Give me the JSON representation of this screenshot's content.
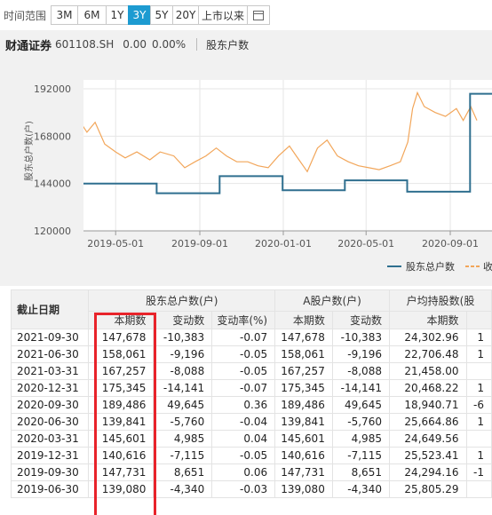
{
  "range_bar": {
    "label": "时间范围",
    "buttons": [
      "3M",
      "6M",
      "1Y",
      "3Y",
      "5Y",
      "20Y",
      "上市以来"
    ],
    "active_index": 3,
    "calendar_icon": "calendar-icon"
  },
  "header": {
    "stock_name": "财通证券",
    "stock_code": "601108.SH",
    "price": "0.00",
    "change_pct": "0.00%",
    "metric": "股东户数"
  },
  "colors": {
    "accent": "#1d9bd1",
    "holders_line": "#2f6f8f",
    "price_line": "#f2a65a",
    "highlight": "#e8232a"
  },
  "chart_data": {
    "type": "line",
    "ylabel": "股东总户数(户)",
    "yticks": [
      "192000",
      "168000",
      "144000",
      "120000"
    ],
    "ylim": [
      120000,
      192000
    ],
    "xticks": [
      "2019-05-01",
      "2019-09-01",
      "2020-01-01",
      "2020-05-01",
      "2020-09-01"
    ],
    "grid": true,
    "legend_position": "bottom-right",
    "legend": [
      "股东总户数",
      "收"
    ],
    "series": [
      {
        "name": "股东总户数",
        "type": "step",
        "points": [
          [
            "2019-03-01",
            144000
          ],
          [
            "2019-06-30",
            139080
          ],
          [
            "2019-09-30",
            147731
          ],
          [
            "2019-12-31",
            140616
          ],
          [
            "2020-03-31",
            145601
          ],
          [
            "2020-06-30",
            139841
          ],
          [
            "2020-09-30",
            189486
          ]
        ]
      },
      {
        "name": "收",
        "type": "line",
        "points": [
          [
            "2019-03-05",
            178000
          ],
          [
            "2019-03-20",
            170000
          ],
          [
            "2019-04-01",
            175000
          ],
          [
            "2019-04-15",
            164000
          ],
          [
            "2019-05-01",
            160000
          ],
          [
            "2019-05-15",
            157000
          ],
          [
            "2019-06-01",
            160000
          ],
          [
            "2019-06-20",
            156000
          ],
          [
            "2019-07-05",
            160000
          ],
          [
            "2019-07-25",
            158000
          ],
          [
            "2019-08-10",
            152000
          ],
          [
            "2019-08-25",
            155000
          ],
          [
            "2019-09-10",
            158000
          ],
          [
            "2019-09-25",
            162000
          ],
          [
            "2019-10-10",
            158000
          ],
          [
            "2019-10-25",
            155000
          ],
          [
            "2019-11-10",
            155000
          ],
          [
            "2019-11-25",
            153000
          ],
          [
            "2019-12-10",
            152000
          ],
          [
            "2019-12-25",
            158000
          ],
          [
            "2020-01-10",
            163000
          ],
          [
            "2020-01-20",
            158000
          ],
          [
            "2020-02-05",
            150000
          ],
          [
            "2020-02-20",
            162000
          ],
          [
            "2020-03-05",
            166000
          ],
          [
            "2020-03-20",
            158000
          ],
          [
            "2020-04-05",
            155000
          ],
          [
            "2020-04-20",
            153000
          ],
          [
            "2020-05-05",
            152000
          ],
          [
            "2020-05-20",
            151000
          ],
          [
            "2020-06-05",
            153000
          ],
          [
            "2020-06-20",
            155000
          ],
          [
            "2020-07-01",
            165000
          ],
          [
            "2020-07-08",
            182000
          ],
          [
            "2020-07-15",
            190000
          ],
          [
            "2020-07-25",
            183000
          ],
          [
            "2020-08-10",
            180000
          ],
          [
            "2020-08-25",
            178000
          ],
          [
            "2020-09-10",
            182000
          ],
          [
            "2020-09-20",
            176000
          ],
          [
            "2020-10-01",
            183000
          ],
          [
            "2020-10-10",
            176000
          ]
        ]
      }
    ]
  },
  "table": {
    "date_header": "截止日期",
    "groups": [
      {
        "label": "股东总户数(户)",
        "span": 3
      },
      {
        "label": "A股户数(户)",
        "span": 2
      },
      {
        "label": "户均持股数(股",
        "span": 2
      }
    ],
    "sub_headers": [
      "本期数",
      "变动数",
      "变动率(%)",
      "本期数",
      "变动数",
      "本期数",
      ""
    ],
    "rows": [
      [
        "2021-09-30",
        "147,678",
        "-10,383",
        "-0.07",
        "147,678",
        "-10,383",
        "24,302.96",
        "1"
      ],
      [
        "2021-06-30",
        "158,061",
        "-9,196",
        "-0.05",
        "158,061",
        "-9,196",
        "22,706.48",
        "1"
      ],
      [
        "2021-03-31",
        "167,257",
        "-8,088",
        "-0.05",
        "167,257",
        "-8,088",
        "21,458.00",
        ""
      ],
      [
        "2020-12-31",
        "175,345",
        "-14,141",
        "-0.07",
        "175,345",
        "-14,141",
        "20,468.22",
        "1"
      ],
      [
        "2020-09-30",
        "189,486",
        "49,645",
        "0.36",
        "189,486",
        "49,645",
        "18,940.71",
        "-6"
      ],
      [
        "2020-06-30",
        "139,841",
        "-5,760",
        "-0.04",
        "139,841",
        "-5,760",
        "25,664.86",
        "1"
      ],
      [
        "2020-03-31",
        "145,601",
        "4,985",
        "0.04",
        "145,601",
        "4,985",
        "24,649.56",
        ""
      ],
      [
        "2019-12-31",
        "140,616",
        "-7,115",
        "-0.05",
        "140,616",
        "-7,115",
        "25,523.41",
        "1"
      ],
      [
        "2019-09-30",
        "147,731",
        "8,651",
        "0.06",
        "147,731",
        "8,651",
        "24,294.16",
        "-1"
      ],
      [
        "2019-06-30",
        "139,080",
        "-4,340",
        "-0.03",
        "139,080",
        "-4,340",
        "25,805.29",
        ""
      ]
    ]
  }
}
